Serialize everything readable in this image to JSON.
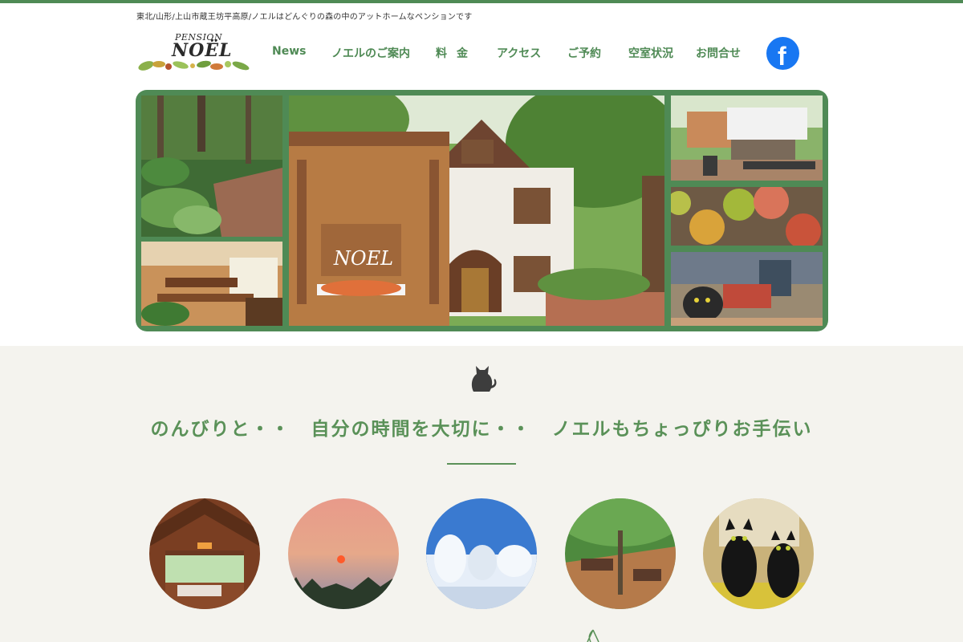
{
  "site": {
    "tagline": "東北/山形/上山市蔵王坊平高原/ノエルはどんぐりの森の中のアットホームなペンションです",
    "logo": {
      "top": "PENSION",
      "main": "NOËL"
    }
  },
  "nav": {
    "items": [
      "News",
      "ノエルのご案内",
      "料金",
      "アクセス",
      "ご予約",
      "空室状況",
      "お問合せ"
    ],
    "facebook_icon": "facebook-icon"
  },
  "colors": {
    "accent": "#4f8a55",
    "headline": "#5a9158",
    "band_bg": "#f4f3ee",
    "facebook": "#1877f2"
  },
  "hero": {
    "sign_text": "NOEL",
    "photos": [
      "forest-garden",
      "dining-room",
      "pension-building",
      "terrace",
      "apples",
      "autumn-decor"
    ]
  },
  "section": {
    "icon": "cat-icon",
    "headline": "のんびりと・・　自分の時間を大切に・・　ノエルもちょっぴりお手伝い"
  },
  "circles": [
    "restaurant-interior",
    "sunset",
    "snow-monsters",
    "wooden-terrace",
    "black-cats"
  ]
}
